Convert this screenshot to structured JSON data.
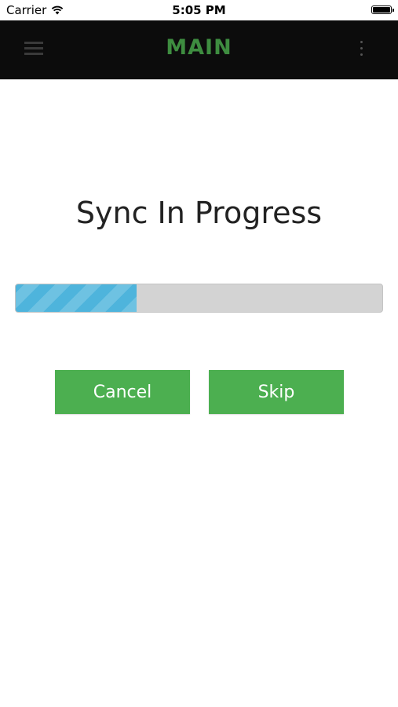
{
  "status_bar": {
    "carrier": "Carrier",
    "time": "5:05 PM"
  },
  "app_bar": {
    "title": "MAIN",
    "title_color": "#3e8d40",
    "menu_icon": "hamburger-menu-icon",
    "overflow_icon": "more-vertical-icon"
  },
  "sync": {
    "title": "Sync In Progress",
    "progress_fraction": 0.33,
    "progress_color": "#4eb4dc",
    "track_color": "#d3d3d3"
  },
  "buttons": {
    "cancel_label": "Cancel",
    "skip_label": "Skip",
    "color": "#4caf50"
  }
}
